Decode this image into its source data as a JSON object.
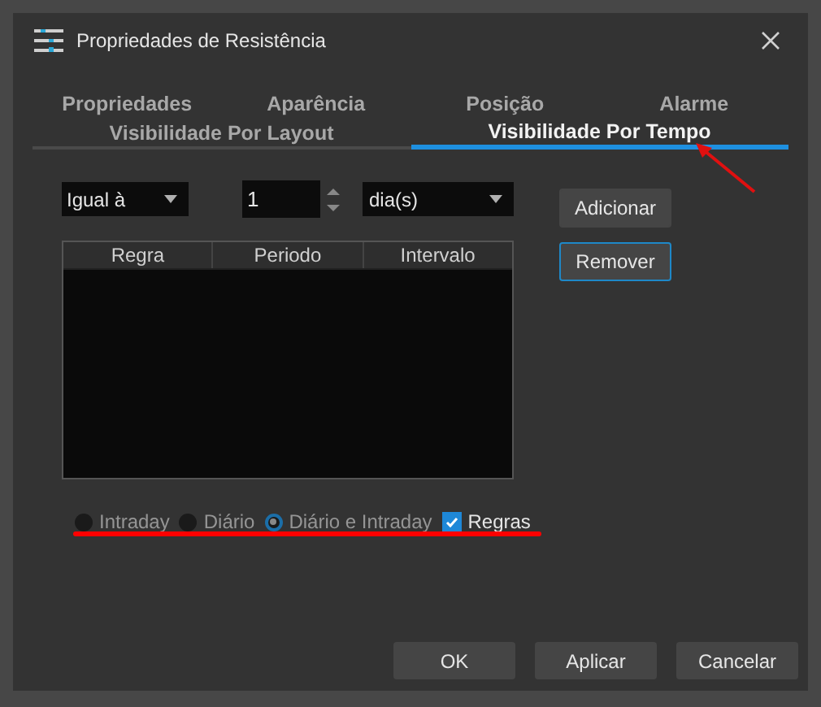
{
  "window": {
    "title": "Propriedades de Resistência"
  },
  "tab_rows": [
    [
      {
        "label": "Propriedades",
        "selected": false
      },
      {
        "label": "Aparência",
        "selected": false
      },
      {
        "label": "Posição",
        "selected": false
      },
      {
        "label": "Alarme",
        "selected": false
      }
    ],
    [
      {
        "label": "Visibilidade Por Layout",
        "selected": false
      },
      {
        "label": "Visibilidade Por Tempo",
        "selected": true
      }
    ]
  ],
  "rule_form": {
    "comparison": "Igual à",
    "amount": "1",
    "unit": "dia(s)"
  },
  "side_buttons": [
    {
      "label": "Adicionar",
      "focused": false
    },
    {
      "label": "Remover",
      "focused": true
    }
  ],
  "table": {
    "columns": [
      "Regra",
      "Periodo",
      "Intervalo"
    ]
  },
  "options": [
    {
      "kind": "radio",
      "label": "Intraday",
      "selected": false
    },
    {
      "kind": "radio",
      "label": "Diário",
      "selected": false
    },
    {
      "kind": "radio",
      "label": "Diário e Intraday",
      "selected": true
    },
    {
      "kind": "checkbox",
      "label": "Regras",
      "checked": true
    }
  ],
  "buttons": [
    "OK",
    "Aplicar",
    "Cancelar"
  ]
}
